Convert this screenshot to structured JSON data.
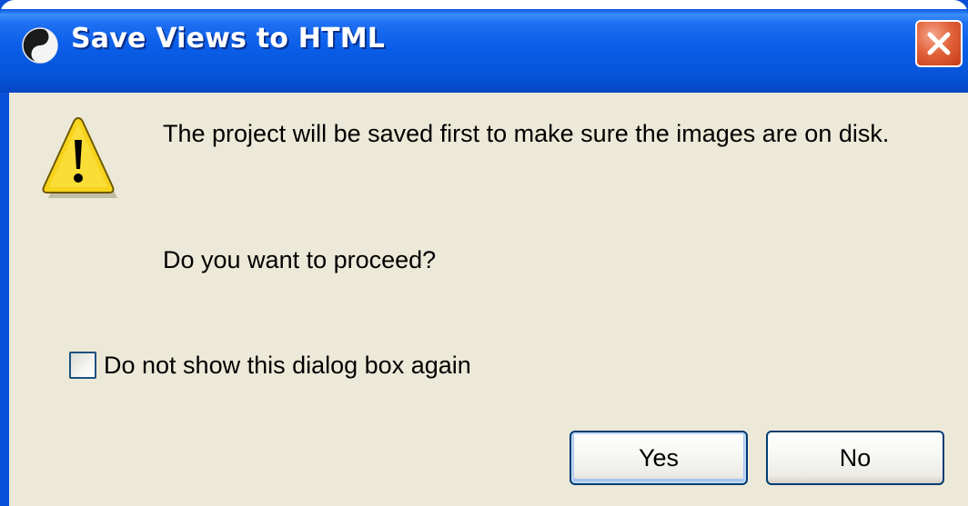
{
  "window": {
    "title": "Save Views to HTML",
    "title_icon": "yin-yang-icon",
    "close_icon": "close-icon"
  },
  "dialog": {
    "icon": "warning-icon",
    "message": "The project will be saved first to make sure the images are on disk.",
    "question": "Do you want to proceed?",
    "checkbox": {
      "label": "Do not show this dialog box again",
      "checked": false
    },
    "buttons": {
      "yes_label": "Yes",
      "no_label": "No"
    }
  },
  "colors": {
    "titlebar_blue": "#0a5ee8",
    "dialog_background": "#ece9d8",
    "close_red": "#e2633c",
    "warning_yellow": "#f7d31c"
  }
}
